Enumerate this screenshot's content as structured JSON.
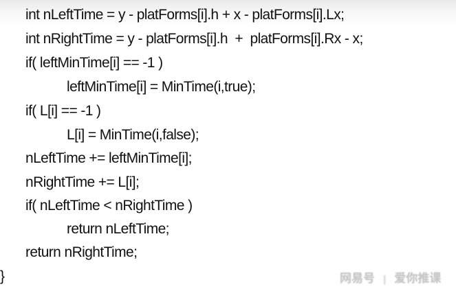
{
  "code_lines": [
    {
      "indent": 1,
      "text": "int nLeftTime = y - platForms[i].h + x - platForms[i].Lx;"
    },
    {
      "indent": 1,
      "text": "int nRightTime = y - platForms[i].h  +  platForms[i].Rx - x;"
    },
    {
      "indent": 1,
      "text": "if( leftMinTime[i] == -1 )"
    },
    {
      "indent": 2,
      "text": "leftMinTime[i] = MinTime(i,true);"
    },
    {
      "indent": 1,
      "text": "if( L[i] == -1 )"
    },
    {
      "indent": 2,
      "text": "L[i] = MinTime(i,false);"
    },
    {
      "indent": 1,
      "text": "nLeftTime += leftMinTime[i];"
    },
    {
      "indent": 1,
      "text": "nRightTime += L[i];"
    },
    {
      "indent": 1,
      "text": "if( nLeftTime < nRightTime )"
    },
    {
      "indent": 2,
      "text": "return nLeftTime;"
    },
    {
      "indent": 1,
      "text": "return nRightTime;"
    },
    {
      "indent": 0,
      "text": "}"
    }
  ],
  "watermark": {
    "brand": "网易号",
    "separator": "|",
    "account": "爱你推课"
  }
}
